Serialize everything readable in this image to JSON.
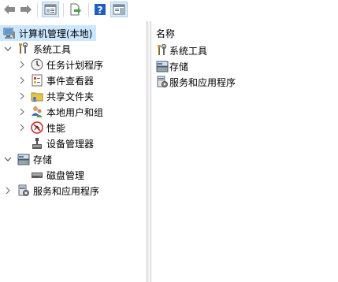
{
  "toolbar": {
    "buttons": [
      {
        "name": "back-button",
        "icon": "arrow-left-icon"
      },
      {
        "name": "forward-button",
        "icon": "arrow-right-icon"
      },
      {
        "name": "show-hide-tree-button",
        "icon": "console-tree-icon"
      },
      {
        "name": "export-list-button",
        "icon": "export-icon"
      },
      {
        "name": "help-button",
        "icon": "help-icon"
      },
      {
        "name": "show-hide-action-pane-button",
        "icon": "action-pane-icon"
      }
    ]
  },
  "tree": {
    "root": "计算机管理(本地)",
    "items": [
      {
        "label": "系统工具",
        "level": 1,
        "expanded": true
      },
      {
        "label": "任务计划程序",
        "level": 2
      },
      {
        "label": "事件查看器",
        "level": 2
      },
      {
        "label": "共享文件夹",
        "level": 2
      },
      {
        "label": "本地用户和组",
        "level": 2
      },
      {
        "label": "性能",
        "level": 2
      },
      {
        "label": "设备管理器",
        "level": 2
      },
      {
        "label": "存储",
        "level": 1,
        "expanded": true
      },
      {
        "label": "磁盘管理",
        "level": 2
      },
      {
        "label": "服务和应用程序",
        "level": 1
      }
    ]
  },
  "list": {
    "column_header": "名称",
    "items": [
      "系统工具",
      "存储",
      "服务和应用程序"
    ]
  },
  "colors": {
    "selection": "#cce8ff",
    "help_icon": "#1f5fc2"
  }
}
